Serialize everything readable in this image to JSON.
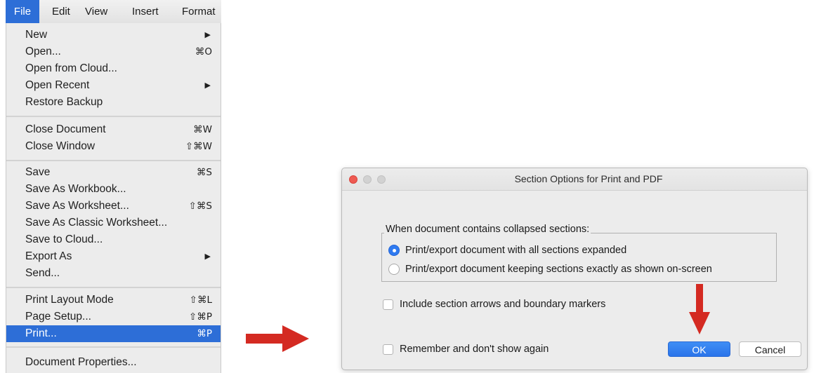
{
  "menubar": {
    "items": [
      "File",
      "Edit",
      "View",
      "Insert",
      "Format"
    ],
    "active_index": 0,
    "highlight_color": "#2d6ed7"
  },
  "file_menu": {
    "items": [
      {
        "label": "New",
        "submenu": "▶"
      },
      {
        "label": "Open...",
        "shortcut": "⌘O"
      },
      {
        "label": "Open from Cloud..."
      },
      {
        "label": "Open Recent",
        "submenu": "▶"
      },
      {
        "label": "Restore Backup"
      },
      {
        "label": "Close Document",
        "shortcut": "⌘W"
      },
      {
        "label": "Close Window",
        "shortcut": "⇧⌘W"
      },
      {
        "label": "Save",
        "shortcut": "⌘S"
      },
      {
        "label": "Save As Workbook..."
      },
      {
        "label": "Save As Worksheet...",
        "shortcut": "⇧⌘S"
      },
      {
        "label": "Save As Classic Worksheet..."
      },
      {
        "label": "Save to Cloud..."
      },
      {
        "label": "Export As",
        "submenu": "▶"
      },
      {
        "label": "Send..."
      },
      {
        "label": "Print Layout Mode",
        "shortcut": "⇧⌘L"
      },
      {
        "label": "Page Setup...",
        "shortcut": "⇧⌘P"
      },
      {
        "label": "Print...",
        "shortcut": "⌘P",
        "highlighted": true
      },
      {
        "label": "Document Properties..."
      }
    ]
  },
  "dialog": {
    "title": "Section Options for Print and PDF",
    "group_label": "When document contains collapsed sections:",
    "radio_expanded": "Print/export document with all sections expanded",
    "radio_as_shown": "Print/export document keeping sections exactly as shown on-screen",
    "selected_radio": "expanded",
    "include_arrows_label": "Include section arrows and boundary markers",
    "remember_label": "Remember and don't show again",
    "ok_label": "OK",
    "cancel_label": "Cancel"
  },
  "annotation": {
    "arrow_color": "#d42a22"
  },
  "icons": [
    "arrow-right-icon",
    "arrow-down-icon",
    "submenu-arrow-icon",
    "close-window-icon",
    "minimize-window-icon",
    "zoom-window-icon"
  ]
}
